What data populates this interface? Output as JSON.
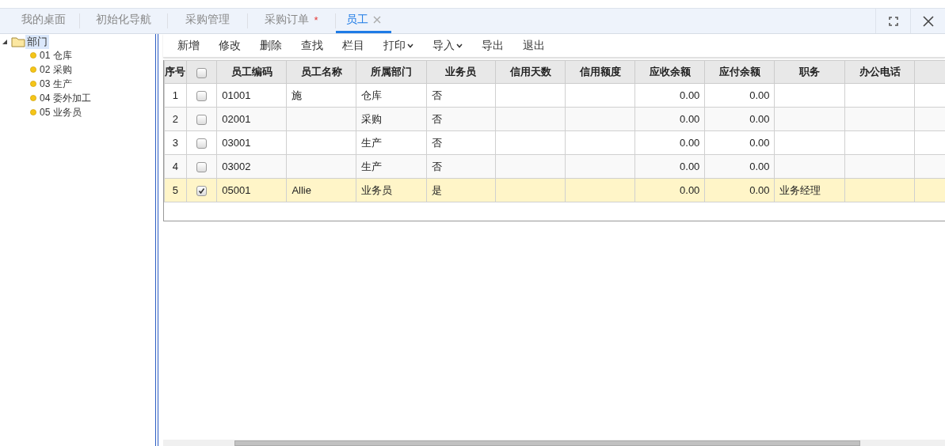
{
  "tabs": [
    {
      "label": "我的桌面",
      "selected": false
    },
    {
      "label": "初始化导航",
      "selected": false
    },
    {
      "label": "采购管理",
      "selected": false
    },
    {
      "label": "采购订单",
      "selected": false,
      "marker": "*"
    },
    {
      "label": "员工",
      "selected": true,
      "closable": true
    }
  ],
  "tree": {
    "label": "部门",
    "expanded": true,
    "children": [
      {
        "label": "01 仓库"
      },
      {
        "label": "02 采购"
      },
      {
        "label": "03 生产"
      },
      {
        "label": "04 委外加工"
      },
      {
        "label": "05 业务员"
      }
    ]
  },
  "toolbar": [
    {
      "label": "新增",
      "dropdown": false
    },
    {
      "label": "修改",
      "dropdown": false
    },
    {
      "label": "删除",
      "dropdown": false
    },
    {
      "label": "查找",
      "dropdown": false
    },
    {
      "label": "栏目",
      "dropdown": false
    },
    {
      "label": "打印",
      "dropdown": true
    },
    {
      "label": "导入",
      "dropdown": true
    },
    {
      "label": "导出",
      "dropdown": false
    },
    {
      "label": "退出",
      "dropdown": false
    }
  ],
  "table": {
    "columns": [
      {
        "label": "序号",
        "kind": "index"
      },
      {
        "kind": "check",
        "checked": false
      },
      {
        "label": "员工编码",
        "kind": "text"
      },
      {
        "label": "员工名称",
        "kind": "text"
      },
      {
        "label": "所属部门",
        "kind": "text"
      },
      {
        "label": "业务员",
        "kind": "text"
      },
      {
        "label": "信用天数",
        "kind": "text"
      },
      {
        "label": "信用额度",
        "kind": "text"
      },
      {
        "label": "应收余额",
        "kind": "number"
      },
      {
        "label": "应付余额",
        "kind": "number"
      },
      {
        "label": "职务",
        "kind": "text"
      },
      {
        "label": "办公电话",
        "kind": "text"
      },
      {
        "kind": "text"
      }
    ],
    "rows": [
      {
        "selected": false,
        "checked": false,
        "cells": [
          "1",
          null,
          "01001",
          "施",
          "仓库",
          "否",
          null,
          null,
          "0.00",
          "0.00",
          null,
          null,
          null
        ]
      },
      {
        "selected": false,
        "checked": false,
        "cells": [
          "2",
          null,
          "02001",
          null,
          "采购",
          "否",
          null,
          null,
          "0.00",
          "0.00",
          null,
          null,
          null
        ]
      },
      {
        "selected": false,
        "checked": false,
        "cells": [
          "3",
          null,
          "03001",
          null,
          "生产",
          "否",
          null,
          null,
          "0.00",
          "0.00",
          null,
          null,
          null
        ]
      },
      {
        "selected": false,
        "checked": false,
        "cells": [
          "4",
          null,
          "03002",
          null,
          "生产",
          "否",
          null,
          null,
          "0.00",
          "0.00",
          null,
          null,
          null
        ]
      },
      {
        "selected": true,
        "checked": true,
        "cells": [
          "5",
          null,
          "05001",
          "Allie",
          "业务员",
          "是",
          null,
          null,
          "0.00",
          "0.00",
          "业务经理",
          null,
          null
        ]
      }
    ]
  }
}
